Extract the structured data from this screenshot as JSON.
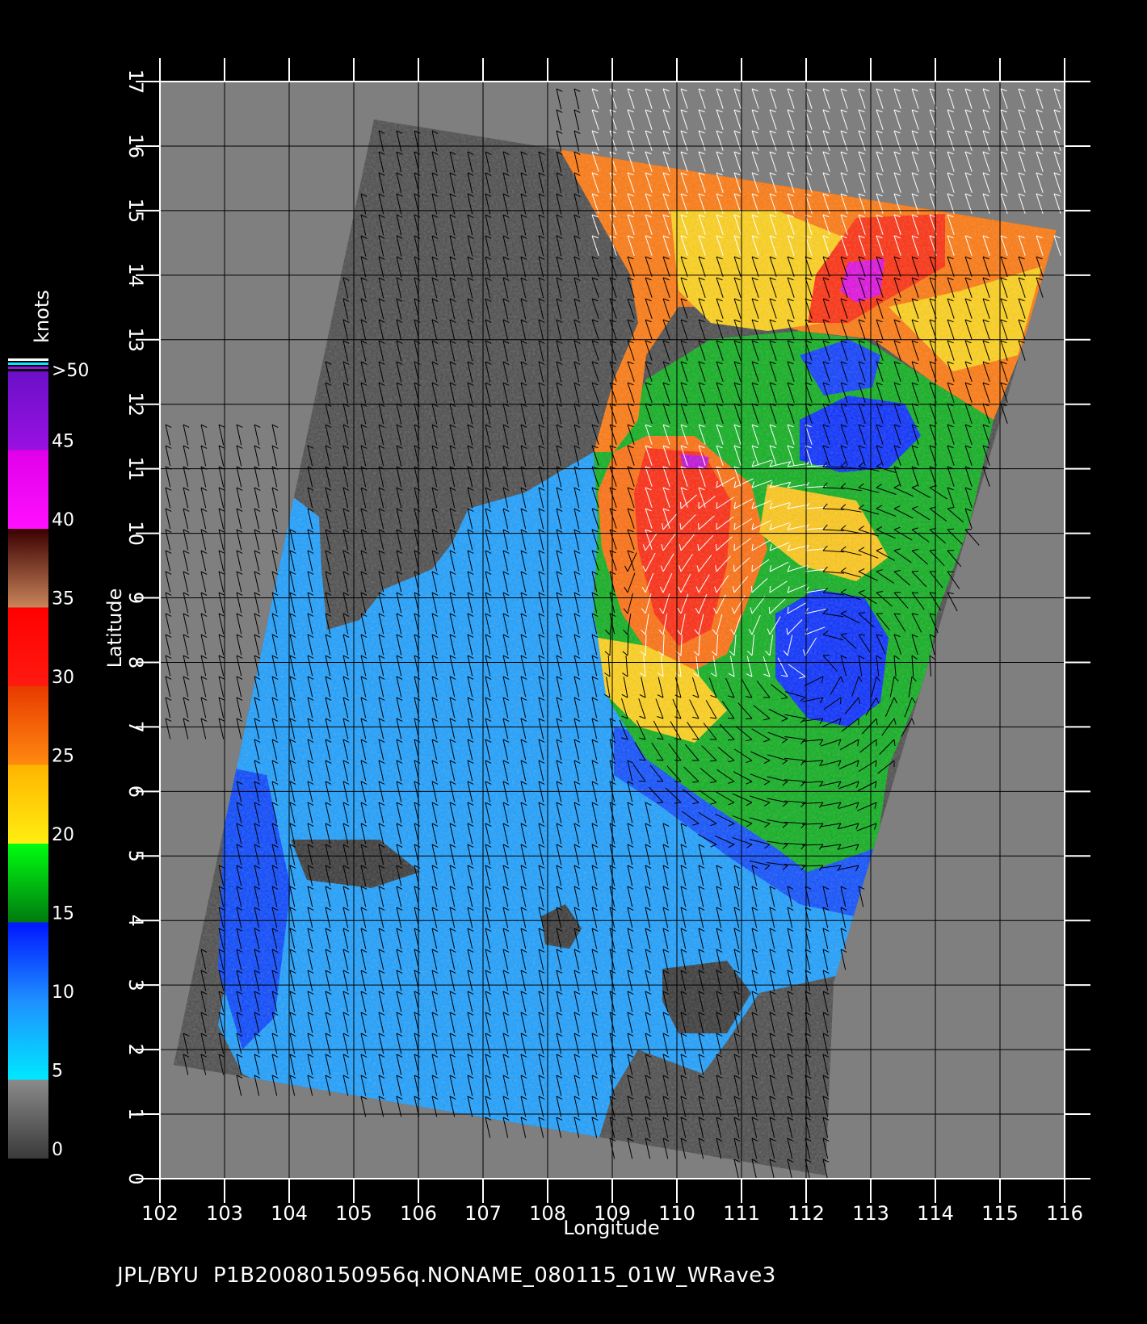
{
  "map": {
    "xlabel": "Longitude",
    "ylabel": "Latitude",
    "lon_range": [
      102,
      116
    ],
    "lat_range": [
      0,
      17
    ],
    "lon_ticks": [
      "102",
      "103",
      "104",
      "105",
      "106",
      "107",
      "108",
      "109",
      "110",
      "111",
      "112",
      "113",
      "114",
      "115",
      "116"
    ],
    "lat_ticks": [
      "0",
      "1",
      "2",
      "3",
      "4",
      "5",
      "6",
      "7",
      "8",
      "9",
      "10",
      "11",
      "12",
      "13",
      "14",
      "15",
      "16",
      "17"
    ]
  },
  "colorbar": {
    "title": "knots",
    "labels": [
      "0",
      "5",
      "10",
      "15",
      "20",
      "25",
      "30",
      "35",
      "40",
      "45",
      ">50"
    ],
    "bands": [
      {
        "from": 0,
        "to": 5,
        "color": "#3a3a3a",
        "color2": "#8a8a8a"
      },
      {
        "from": 5,
        "to": 10,
        "color": "#00e8ff",
        "color2": "#1e90ff"
      },
      {
        "from": 10,
        "to": 15,
        "color": "#1e90ff",
        "color2": "#0016ff"
      },
      {
        "from": 15,
        "to": 20,
        "color": "#007a10",
        "color2": "#00ff10"
      },
      {
        "from": 20,
        "to": 25,
        "color": "#ffee10",
        "color2": "#ffb400"
      },
      {
        "from": 25,
        "to": 30,
        "color": "#ff8a10",
        "color2": "#e83a00"
      },
      {
        "from": 30,
        "to": 35,
        "color": "#ff1a10",
        "color2": "#ff0000"
      },
      {
        "from": 35,
        "to": 40,
        "color": "#c8845a",
        "color2": "#3a0000"
      },
      {
        "from": 40,
        "to": 45,
        "color": "#ff10ff",
        "color2": "#e000e8"
      },
      {
        "from": 45,
        "to": 50,
        "color": "#9a10e0",
        "color2": "#6a10c8"
      }
    ]
  },
  "colors": {
    "background": "#000000",
    "land_mask": "#7f7f7f",
    "swath_no_data": "#4d4d4d",
    "grid": "#000000",
    "text": "#ffffff"
  },
  "caption": "JPL/BYU  P1B20080150956q.NONAME_080115_01W_WRave3"
}
